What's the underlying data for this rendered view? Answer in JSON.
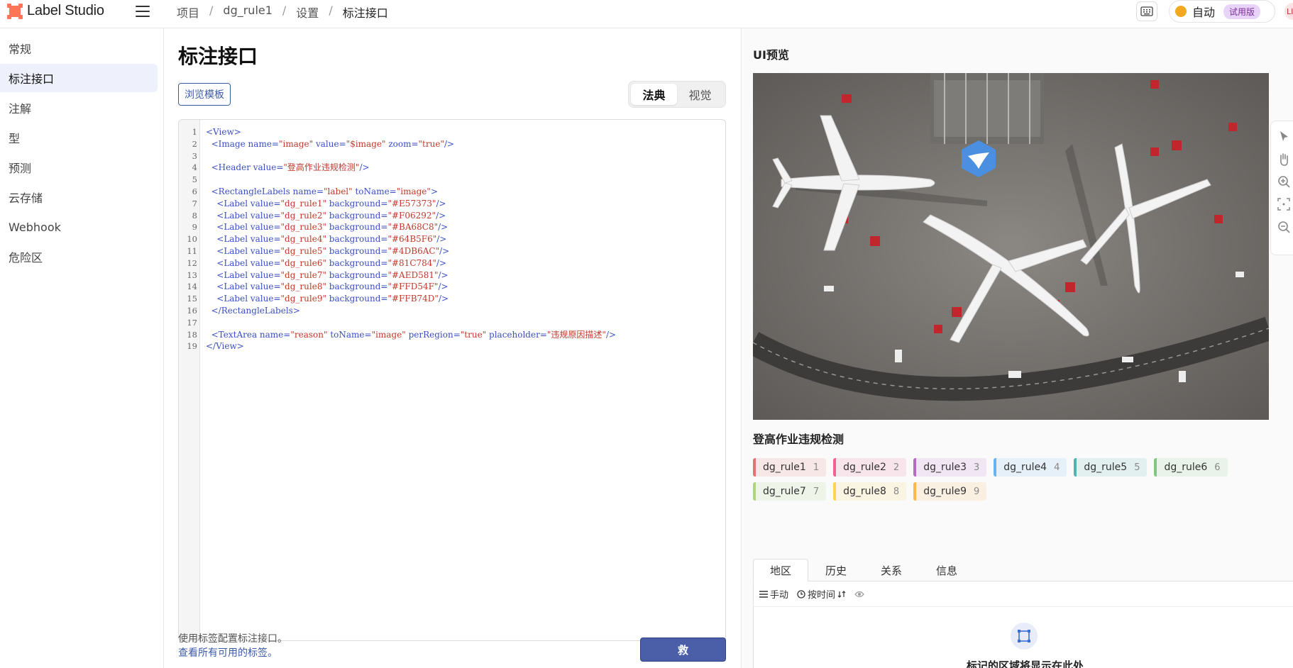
{
  "app": {
    "name": "Label Studio"
  },
  "breadcrumb": [
    "项目",
    "dg_rule1",
    "设置",
    "标注接口"
  ],
  "topbar": {
    "mode_label": "自动",
    "trial_badge": "试用版",
    "avatar_initials": "LI"
  },
  "sidebar": {
    "items": [
      "常规",
      "标注接口",
      "注解",
      "型",
      "预测",
      "云存储",
      "Webhook",
      "危险区"
    ],
    "active_index": 1
  },
  "config": {
    "title": "标注接口",
    "browse_templates": "浏览模板",
    "view_modes": [
      "法典",
      "视觉"
    ],
    "active_mode": "法典",
    "hint_text": "使用标签配置标注接口。",
    "hint_link": "查看所有可用的标签。",
    "save_label": "救",
    "code_lines": [
      "<View>",
      "  <Image name=\"image\" value=\"$image\" zoom=\"true\"/>",
      "",
      "  <Header value=\"登高作业违规检测\"/>",
      "",
      "  <RectangleLabels name=\"label\" toName=\"image\">",
      "    <Label value=\"dg_rule1\" background=\"#E57373\"/>",
      "    <Label value=\"dg_rule2\" background=\"#F06292\"/>",
      "    <Label value=\"dg_rule3\" background=\"#BA68C8\"/>",
      "    <Label value=\"dg_rule4\" background=\"#64B5F6\"/>",
      "    <Label value=\"dg_rule5\" background=\"#4DB6AC\"/>",
      "    <Label value=\"dg_rule6\" background=\"#81C784\"/>",
      "    <Label value=\"dg_rule7\" background=\"#AED581\"/>",
      "    <Label value=\"dg_rule8\" background=\"#FFD54F\"/>",
      "    <Label value=\"dg_rule9\" background=\"#FFB74D\"/>",
      "  </RectangleLabels>",
      "",
      "  <TextArea name=\"reason\" toName=\"image\" perRegion=\"true\" placeholder=\"违规原因描述\"/>",
      "</View>"
    ]
  },
  "preview": {
    "title": "UI预览",
    "header": "登高作业违规检测",
    "labels": [
      {
        "name": "dg_rule1",
        "hotkey": "1",
        "color": "#E57373"
      },
      {
        "name": "dg_rule2",
        "hotkey": "2",
        "color": "#F06292"
      },
      {
        "name": "dg_rule3",
        "hotkey": "3",
        "color": "#BA68C8"
      },
      {
        "name": "dg_rule4",
        "hotkey": "4",
        "color": "#64B5F6"
      },
      {
        "name": "dg_rule5",
        "hotkey": "5",
        "color": "#4DB6AC"
      },
      {
        "name": "dg_rule6",
        "hotkey": "6",
        "color": "#81C784"
      },
      {
        "name": "dg_rule7",
        "hotkey": "7",
        "color": "#AED581"
      },
      {
        "name": "dg_rule8",
        "hotkey": "8",
        "color": "#FFD54F"
      },
      {
        "name": "dg_rule9",
        "hotkey": "9",
        "color": "#FFB74D"
      }
    ],
    "tabs": [
      "地区",
      "历史",
      "关系",
      "信息"
    ],
    "active_tab": "地区",
    "region_toolbar": {
      "manual": "手动",
      "sort": "按时间"
    },
    "empty_text": "标记的区域将显示在此处"
  }
}
